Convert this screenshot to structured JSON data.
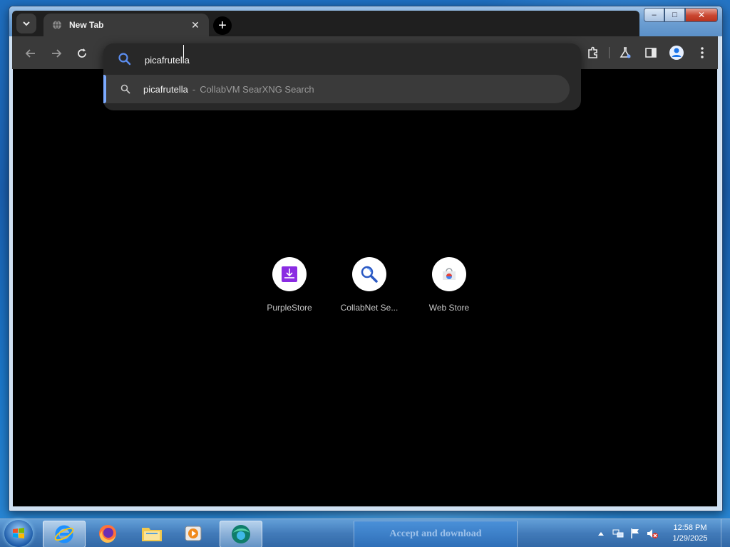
{
  "browser": {
    "tab": {
      "title": "New Tab"
    },
    "new_tab_symbol": "+",
    "omnibox": {
      "value": "picafrutella",
      "suggestion": {
        "query": "picafrutella",
        "separator": "-",
        "engine": "CollabVM SearXNG Search"
      }
    },
    "shortcuts": [
      {
        "label": "PurpleStore",
        "icon": "purplestore-icon"
      },
      {
        "label": "CollabNet Se...",
        "icon": "collabnet-search-icon"
      },
      {
        "label": "Web Store",
        "icon": "web-store-icon"
      }
    ],
    "caption": {
      "minimize": "–",
      "maximize": "□",
      "close": "✕"
    }
  },
  "taskbar": {
    "items": [
      {
        "name": "internet-explorer",
        "icon": "ie-icon"
      },
      {
        "name": "firefox",
        "icon": "firefox-icon"
      },
      {
        "name": "file-explorer",
        "icon": "folder-icon"
      },
      {
        "name": "media-player",
        "icon": "media-player-icon"
      },
      {
        "name": "browser",
        "icon": "browser-icon"
      }
    ],
    "notification": "Accept and download",
    "clock": {
      "time": "12:58 PM",
      "date": "1/29/2025"
    }
  },
  "colors": {
    "accent": "#7caaff",
    "tab_bg": "#3a3a3a",
    "page_bg": "#000000"
  }
}
